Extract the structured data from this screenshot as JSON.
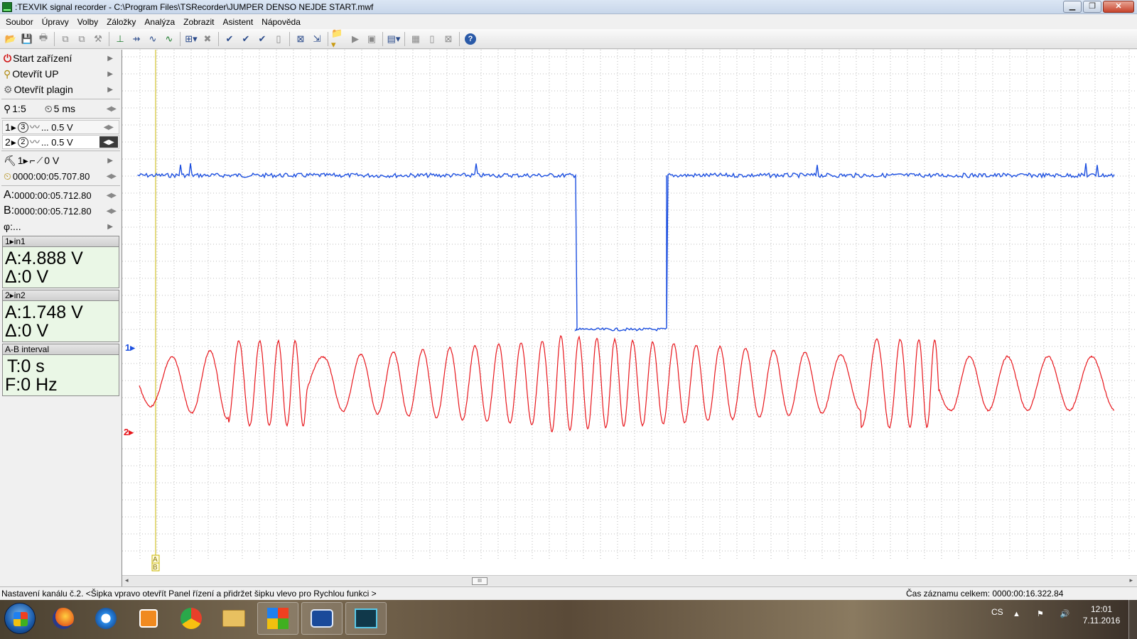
{
  "window": {
    "title": ":TEXVIK  signal recorder - C:\\Program Files\\TSRecorder\\JUMPER DENSO NEJDE START.mwf",
    "minimize": "▁",
    "restore": "❐",
    "close": "✕"
  },
  "menu": [
    "Soubor",
    "Úpravy",
    "Volby",
    "Záložky",
    "Analýza",
    "Zobrazit",
    "Asistent",
    "Nápověda"
  ],
  "left_panel": {
    "start_device": "Start zařízení",
    "open_up": "Otevřít UP",
    "open_plugin": "Otevřít plagin",
    "zoom": "1:5",
    "timebase": "5 ms",
    "channel1": {
      "label": "1",
      "index": "3",
      "scale": "... 0.5 V"
    },
    "channel2": {
      "label": "2",
      "index": "2",
      "scale": "... 0.5 V"
    },
    "trigger": {
      "channel": "1",
      "level": "0 V"
    },
    "trigger_time": "0000:00:05.707.80",
    "cursor_a": {
      "label": "A:",
      "time": "0000:00:05.712.80"
    },
    "cursor_b": {
      "label": "B:",
      "time": "0000:00:05.712.80"
    },
    "phi": "φ:..."
  },
  "readouts": {
    "in1": {
      "header": "1▸in1",
      "a": "A:4.888 V",
      "delta": "Δ:0 V"
    },
    "in2": {
      "header": "2▸in2",
      "a": "A:1.748 V",
      "delta": "Δ:0 V"
    },
    "interval": {
      "header": "A-B interval",
      "t": "T:0 s",
      "f": "F:0 Hz"
    }
  },
  "plot": {
    "marker1": "1▸",
    "marker2": "2▸",
    "cursor_label_a": "A",
    "cursor_label_b": "B",
    "colors": {
      "ch1": "#1c4fe0",
      "ch2": "#e8161c",
      "cursor": "#c8b400",
      "grid": "#a8a8a8"
    }
  },
  "scrollbar": {
    "left": "◂",
    "right": "▸",
    "thumb": "III"
  },
  "status": {
    "hint": "Nastavení kanálu č.2. <Šipka vpravo otevřít Panel řízení a přidržet šipku vlevo pro Rychlou funkci >",
    "total_time": "Čas záznamu celkem: 0000:00:16.322.84"
  },
  "taskbar": {
    "lang": "CS",
    "tray_icons": "▲ ⚑ 🔊",
    "time": "12:01",
    "date": "7.11.2016"
  }
}
